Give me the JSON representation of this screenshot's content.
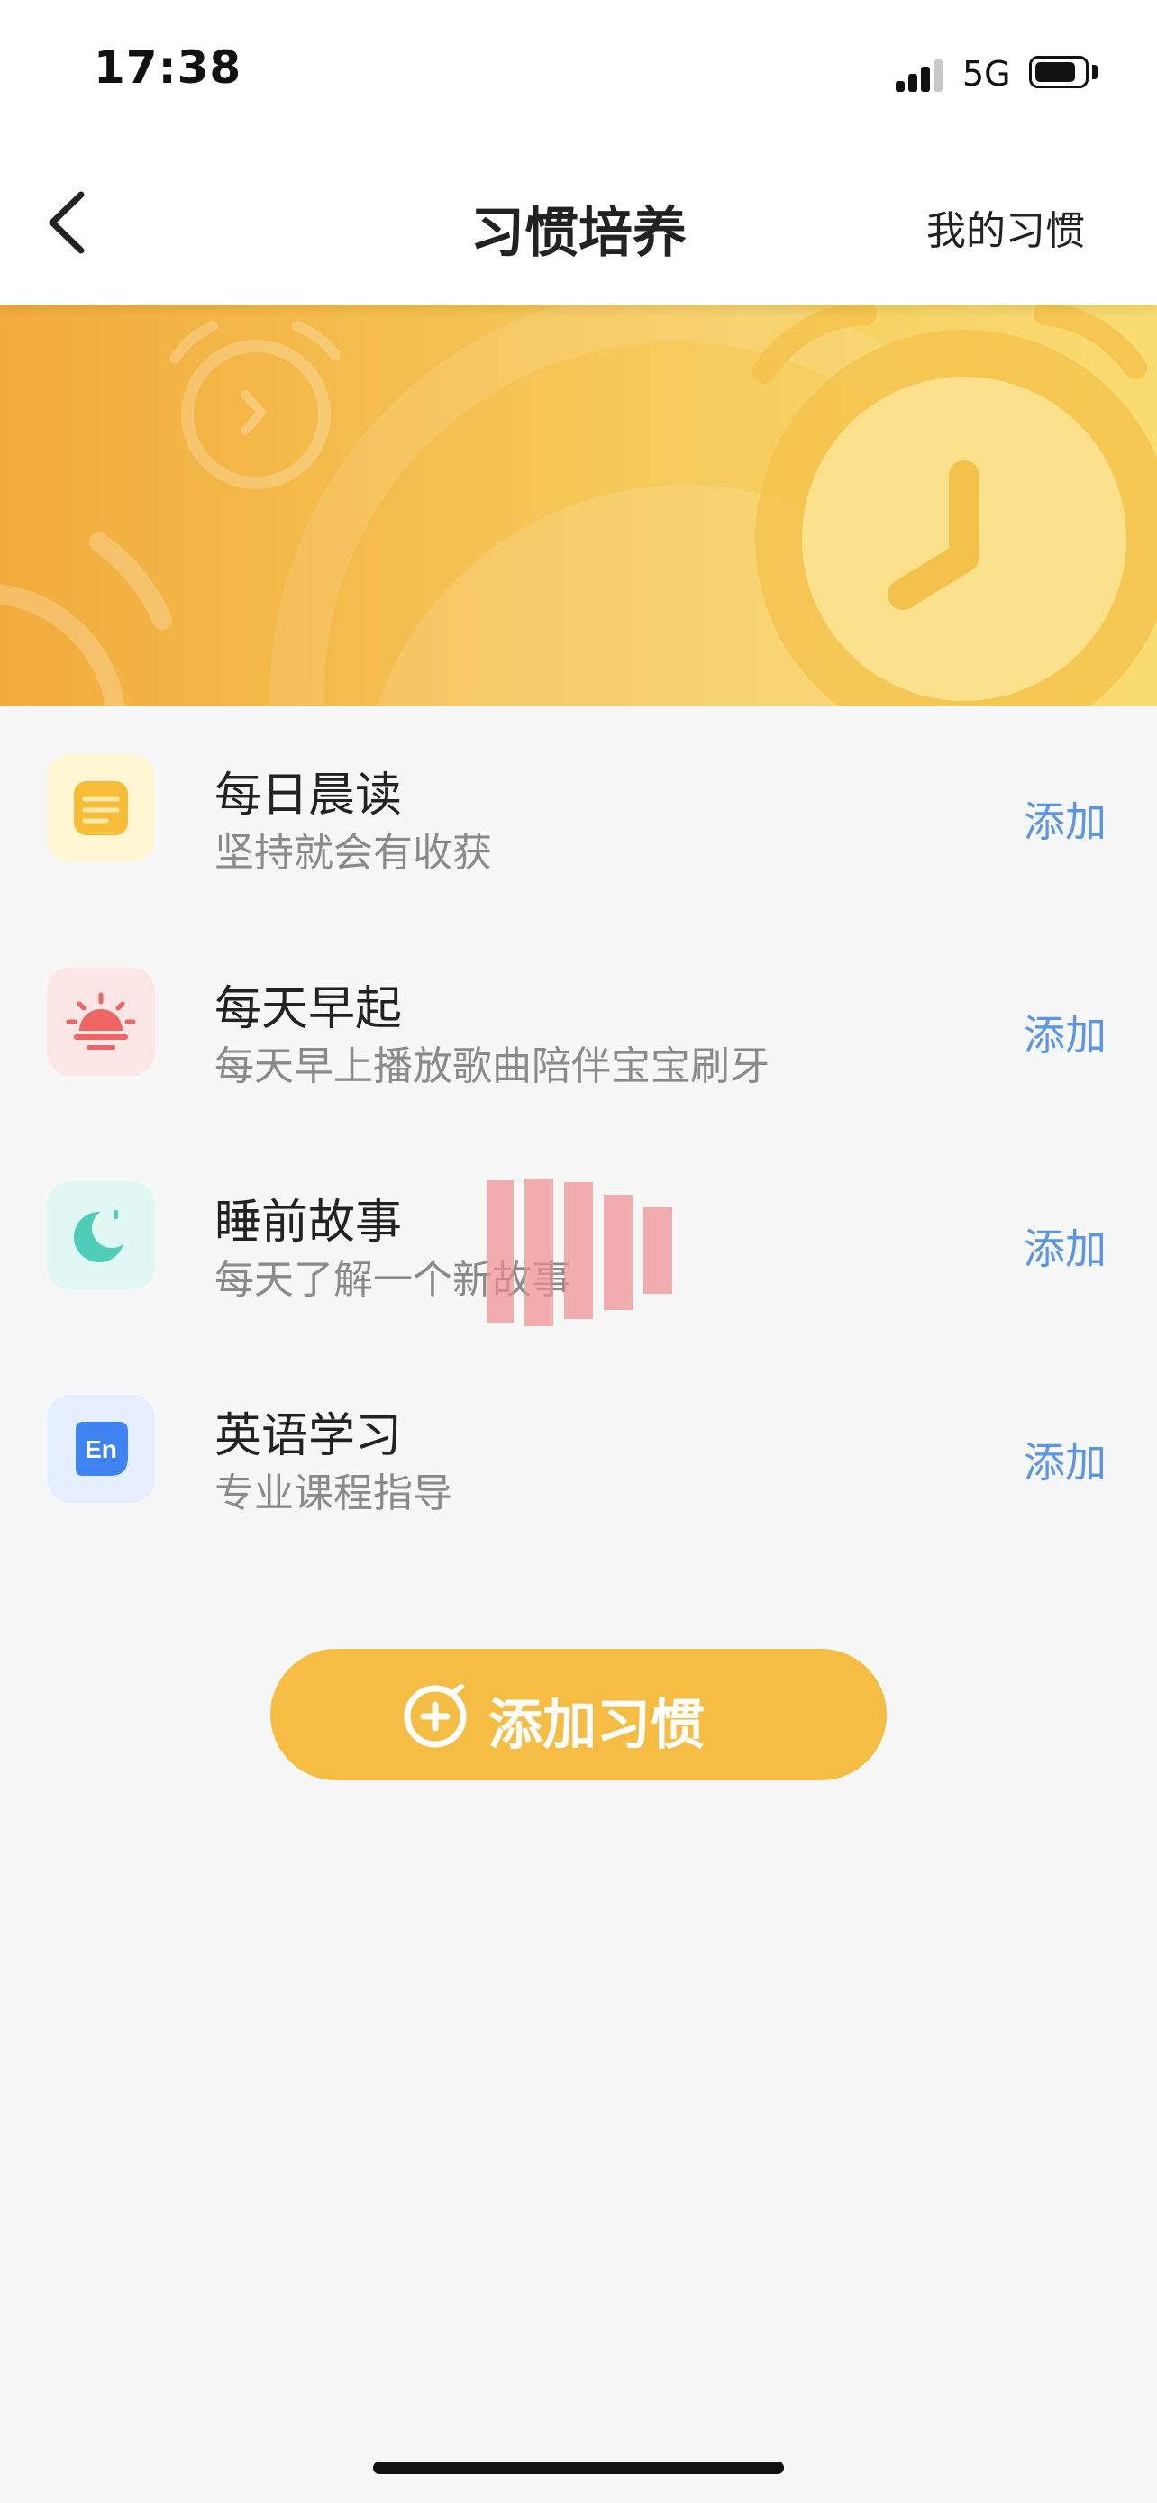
{
  "status_bar": {
    "time": "17:38",
    "network": "5G"
  },
  "nav": {
    "title": "习惯培养",
    "right_label": "我的习惯"
  },
  "colors": {
    "accent": "#f5bd43",
    "link": "#5b95e6"
  },
  "habits": [
    {
      "title": "每日晨读",
      "desc": "坚持就会有收获",
      "action": "添加",
      "icon": "book-icon"
    },
    {
      "title": "每天早起",
      "desc": "每天早上播放歌曲陪伴宝宝刷牙",
      "action": "添加",
      "icon": "sunrise-icon"
    },
    {
      "title": "睡前故事",
      "desc": "每天了解一个新故事",
      "action": "添加",
      "icon": "moon-icon"
    },
    {
      "title": "英语学习",
      "desc": "专业课程指导",
      "action": "添加",
      "icon": "english-icon",
      "icon_text": "En"
    }
  ],
  "add_button": {
    "label": "添加习惯"
  }
}
